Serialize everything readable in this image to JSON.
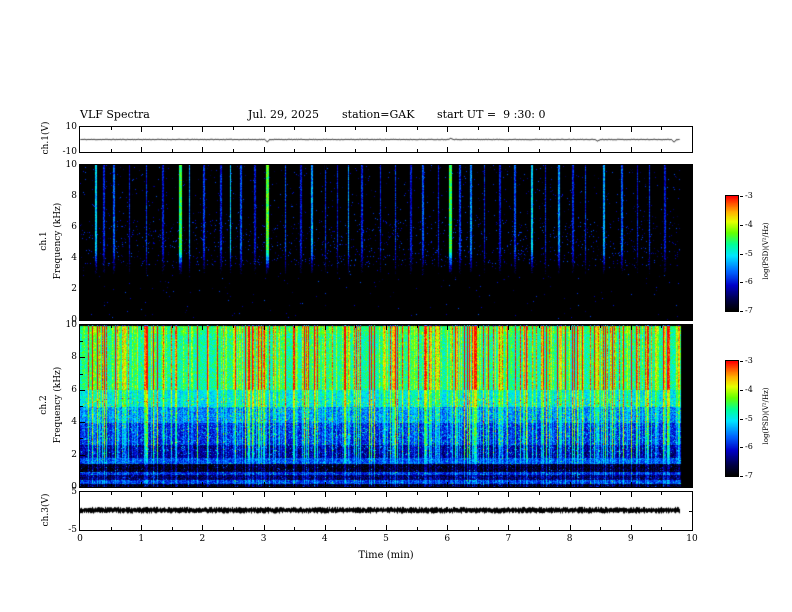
{
  "title": "VLF Spectra",
  "header": {
    "date": "Jul. 29, 2025",
    "station": "station=GAK",
    "start_ut": "start UT =  9 :30: 0"
  },
  "x_axis": {
    "label": "Time (min)",
    "min": 0,
    "max": 10,
    "ticks": [
      0,
      1,
      2,
      3,
      4,
      5,
      6,
      7,
      8,
      9,
      10
    ]
  },
  "colors": {
    "frame": "#000000",
    "background": "#ffffff",
    "trace": "#000000"
  },
  "colormap": [
    [
      0,
      "#000000"
    ],
    [
      0.1,
      "#00004b"
    ],
    [
      0.22,
      "#0000c8"
    ],
    [
      0.34,
      "#0064ff"
    ],
    [
      0.48,
      "#00e6ff"
    ],
    [
      0.58,
      "#00ff96"
    ],
    [
      0.68,
      "#64ff00"
    ],
    [
      0.78,
      "#e6ff00"
    ],
    [
      0.86,
      "#ffb400"
    ],
    [
      0.94,
      "#ff5000"
    ],
    [
      1,
      "#ff0000"
    ]
  ],
  "chart_data": [
    {
      "type": "line",
      "name": "ch1-voltage",
      "ylabel": "ch.1(V)",
      "ylim": [
        -10,
        10
      ],
      "yticks": [
        10,
        -10
      ],
      "baseline": 0,
      "noise_amp": 0.2,
      "data_end": 9.8,
      "spikes": [
        {
          "t": 3.05,
          "amp": -2.0
        },
        {
          "t": 6.05,
          "amp": 1.2
        },
        {
          "t": 8.45,
          "amp": -1.3
        },
        {
          "t": 9.7,
          "amp": -2.2
        }
      ]
    },
    {
      "type": "heatmap",
      "name": "ch1-spectrogram",
      "row_label": "ch.1",
      "ylabel": "Frequency (kHz)",
      "ylim": [
        0,
        10
      ],
      "yticks": [
        0,
        2,
        4,
        6,
        8,
        10
      ],
      "value_range": [
        -7,
        -3
      ],
      "background_level": -7,
      "data_end": 9.8,
      "colorbar": {
        "label": "log(PSD)(V²/Hz)",
        "ticks": [
          -3,
          -4,
          -5,
          -6,
          -7
        ],
        "min": -7,
        "max": -3
      },
      "streaks": [
        [
          0.25,
          -5.2
        ],
        [
          0.38,
          -6.0
        ],
        [
          0.55,
          -5.7
        ],
        [
          0.8,
          -6.1
        ],
        [
          1.08,
          -5.9
        ],
        [
          1.35,
          -6.1
        ],
        [
          1.63,
          -4.5
        ],
        [
          1.78,
          -5.5
        ],
        [
          2.02,
          -5.9
        ],
        [
          2.3,
          -6.0
        ],
        [
          2.45,
          -5.2
        ],
        [
          2.62,
          -5.8
        ],
        [
          2.85,
          -6.1
        ],
        [
          3.05,
          -4.4
        ],
        [
          3.35,
          -5.8
        ],
        [
          3.6,
          -6.1
        ],
        [
          3.78,
          -5.4
        ],
        [
          4.0,
          -6.0
        ],
        [
          4.2,
          -6.1
        ],
        [
          4.38,
          -5.5
        ],
        [
          4.6,
          -6.0
        ],
        [
          4.9,
          -6.1
        ],
        [
          5.15,
          -5.9
        ],
        [
          5.4,
          -6.1
        ],
        [
          5.6,
          -5.8
        ],
        [
          5.85,
          -6.0
        ],
        [
          6.05,
          -4.5
        ],
        [
          6.2,
          -5.9
        ],
        [
          6.38,
          -5.5
        ],
        [
          6.6,
          -6.0
        ],
        [
          6.85,
          -6.1
        ],
        [
          7.1,
          -5.8
        ],
        [
          7.38,
          -5.2
        ],
        [
          7.6,
          -6.0
        ],
        [
          7.82,
          -5.5
        ],
        [
          8.05,
          -6.0
        ],
        [
          8.25,
          -5.9
        ],
        [
          8.55,
          -5.4
        ],
        [
          8.85,
          -5.7
        ],
        [
          9.1,
          -6.1
        ],
        [
          9.3,
          -5.9
        ],
        [
          9.55,
          -6.1
        ]
      ]
    },
    {
      "type": "heatmap",
      "name": "ch2-spectrogram",
      "row_label": "ch.2",
      "ylabel": "Frequency (kHz)",
      "ylim": [
        0,
        10
      ],
      "yticks": [
        0,
        2,
        4,
        6,
        8,
        10
      ],
      "value_range": [
        -7,
        -3
      ],
      "background_level": -7,
      "data_end": 9.82,
      "colorbar": {
        "label": "log(PSD)(V²/Hz)",
        "ticks": [
          -3,
          -4,
          -5,
          -6,
          -7
        ],
        "min": -7,
        "max": -3
      },
      "freq_bands": [
        [
          0,
          0.2,
          -6.8
        ],
        [
          0.2,
          0.45,
          -5.8
        ],
        [
          0.45,
          0.75,
          -6.5
        ],
        [
          0.75,
          0.95,
          -5.9
        ],
        [
          0.95,
          1.45,
          -6.8
        ],
        [
          1.45,
          1.8,
          -5.7
        ],
        [
          1.8,
          2.6,
          -6.1
        ],
        [
          2.6,
          4,
          -5.7
        ],
        [
          4,
          5,
          -5.35
        ],
        [
          5,
          6,
          -4.85
        ],
        [
          6,
          9.5,
          -4.45
        ],
        [
          9.5,
          10,
          -4.3
        ]
      ]
    },
    {
      "type": "line",
      "name": "ch3-voltage",
      "ylabel": "ch.3(V)",
      "ylim": [
        -5,
        5
      ],
      "yticks": [
        5,
        -5
      ],
      "baseline": 0.2,
      "noise_amp": 0.55,
      "data_end": 9.8,
      "thick": true
    }
  ]
}
